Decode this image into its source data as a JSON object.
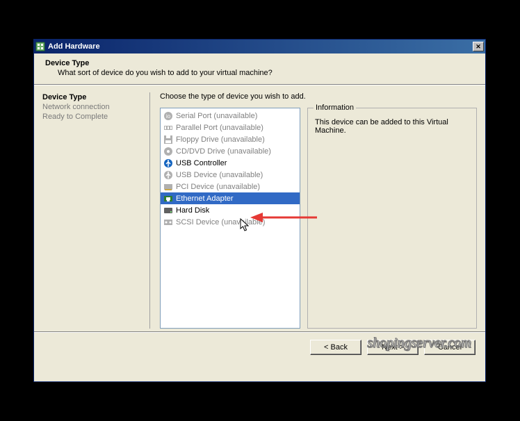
{
  "window": {
    "title": "Add Hardware"
  },
  "header": {
    "title": "Device Type",
    "subtitle": "What sort of device do you wish to add to your virtual machine?"
  },
  "nav": {
    "items": [
      {
        "label": "Device Type",
        "active": true
      },
      {
        "label": "Network connection",
        "active": false
      },
      {
        "label": "Ready to Complete",
        "active": false
      }
    ]
  },
  "main": {
    "instruction": "Choose the type of device you wish to add."
  },
  "devices": [
    {
      "label": "Serial Port (unavailable)",
      "icon": "serial",
      "enabled": false,
      "selected": false
    },
    {
      "label": "Parallel Port (unavailable)",
      "icon": "parallel",
      "enabled": false,
      "selected": false
    },
    {
      "label": "Floppy Drive (unavailable)",
      "icon": "floppy",
      "enabled": false,
      "selected": false
    },
    {
      "label": "CD/DVD Drive (unavailable)",
      "icon": "cd",
      "enabled": false,
      "selected": false
    },
    {
      "label": "USB Controller",
      "icon": "usb",
      "enabled": true,
      "selected": false
    },
    {
      "label": "USB Device (unavailable)",
      "icon": "usbdev",
      "enabled": false,
      "selected": false
    },
    {
      "label": "PCI Device (unavailable)",
      "icon": "pci",
      "enabled": false,
      "selected": false
    },
    {
      "label": "Ethernet Adapter",
      "icon": "ethernet",
      "enabled": true,
      "selected": true
    },
    {
      "label": "Hard Disk",
      "icon": "hdd",
      "enabled": true,
      "selected": false
    },
    {
      "label": "SCSI Device (unavailable)",
      "icon": "scsi",
      "enabled": false,
      "selected": false
    }
  ],
  "info": {
    "legend": "Information",
    "text": "This device can be added to this Virtual Machine."
  },
  "buttons": {
    "back": "< Back",
    "next": "Next >",
    "cancel": "Cancel"
  },
  "watermark": "shopingserver.com",
  "icon_colors": {
    "serial": "#1e5fb4",
    "parallel": "#d47a1e",
    "floppy": "#2e7d32",
    "cd": "#616161",
    "usb": "#1565c0",
    "usbdev": "#1565c0",
    "pci": "#2e7d32",
    "ethernet": "#2e7d32",
    "hdd": "#616161",
    "scsi": "#1565c0"
  }
}
